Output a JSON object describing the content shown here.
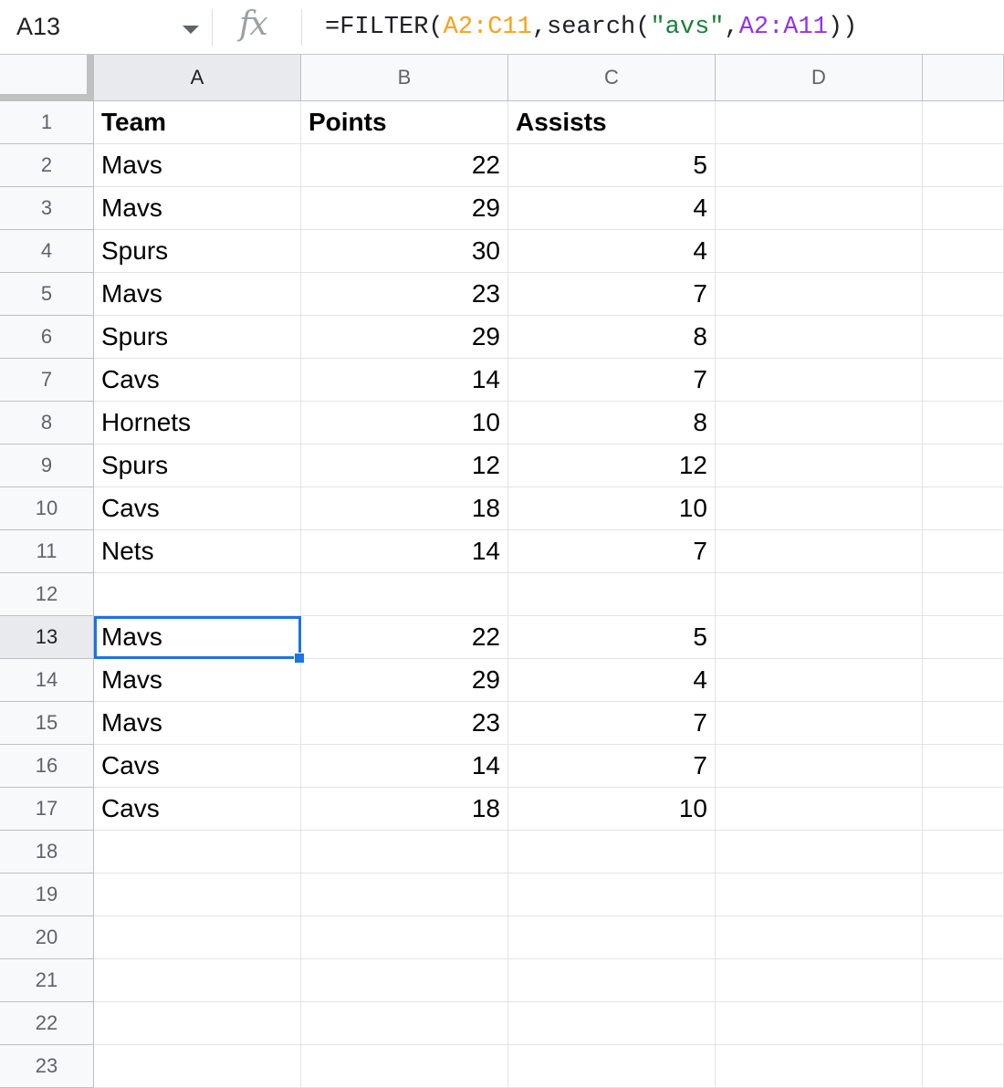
{
  "name_box": "A13",
  "formula_bar": {
    "fx_icon": "fx",
    "formula_tokens": [
      {
        "text": "=FILTER(",
        "color": "#202124"
      },
      {
        "text": "A2:C11",
        "color": "#f7a21a"
      },
      {
        "text": ",search(",
        "color": "#202124"
      },
      {
        "text": "\"avs\"",
        "color": "#188038"
      },
      {
        "text": ",",
        "color": "#202124"
      },
      {
        "text": "A2:A11",
        "color": "#9334e6"
      },
      {
        "text": "))",
        "color": "#202124"
      }
    ]
  },
  "columns": [
    "A",
    "B",
    "C",
    "D"
  ],
  "active_cell": {
    "column": "A",
    "row": "13"
  },
  "rows": [
    {
      "n": "1",
      "cells": [
        "Team",
        "Points",
        "Assists",
        ""
      ],
      "bold": true
    },
    {
      "n": "2",
      "cells": [
        "Mavs",
        "22",
        "5",
        ""
      ]
    },
    {
      "n": "3",
      "cells": [
        "Mavs",
        "29",
        "4",
        ""
      ]
    },
    {
      "n": "4",
      "cells": [
        "Spurs",
        "30",
        "4",
        ""
      ]
    },
    {
      "n": "5",
      "cells": [
        "Mavs",
        "23",
        "7",
        ""
      ]
    },
    {
      "n": "6",
      "cells": [
        "Spurs",
        "29",
        "8",
        ""
      ]
    },
    {
      "n": "7",
      "cells": [
        "Cavs",
        "14",
        "7",
        ""
      ]
    },
    {
      "n": "8",
      "cells": [
        "Hornets",
        "10",
        "8",
        ""
      ]
    },
    {
      "n": "9",
      "cells": [
        "Spurs",
        "12",
        "12",
        ""
      ]
    },
    {
      "n": "10",
      "cells": [
        "Cavs",
        "18",
        "10",
        ""
      ]
    },
    {
      "n": "11",
      "cells": [
        "Nets",
        "14",
        "7",
        ""
      ]
    },
    {
      "n": "12",
      "cells": [
        "",
        "",
        "",
        ""
      ]
    },
    {
      "n": "13",
      "cells": [
        "Mavs",
        "22",
        "5",
        ""
      ]
    },
    {
      "n": "14",
      "cells": [
        "Mavs",
        "29",
        "4",
        ""
      ]
    },
    {
      "n": "15",
      "cells": [
        "Mavs",
        "23",
        "7",
        ""
      ]
    },
    {
      "n": "16",
      "cells": [
        "Cavs",
        "14",
        "7",
        ""
      ]
    },
    {
      "n": "17",
      "cells": [
        "Cavs",
        "18",
        "10",
        ""
      ]
    },
    {
      "n": "18",
      "cells": [
        "",
        "",
        "",
        ""
      ]
    },
    {
      "n": "19",
      "cells": [
        "",
        "",
        "",
        ""
      ]
    },
    {
      "n": "20",
      "cells": [
        "",
        "",
        "",
        ""
      ]
    },
    {
      "n": "21",
      "cells": [
        "",
        "",
        "",
        ""
      ]
    },
    {
      "n": "22",
      "cells": [
        "",
        "",
        "",
        ""
      ]
    },
    {
      "n": "23",
      "cells": [
        "",
        "",
        "",
        ""
      ]
    }
  ]
}
